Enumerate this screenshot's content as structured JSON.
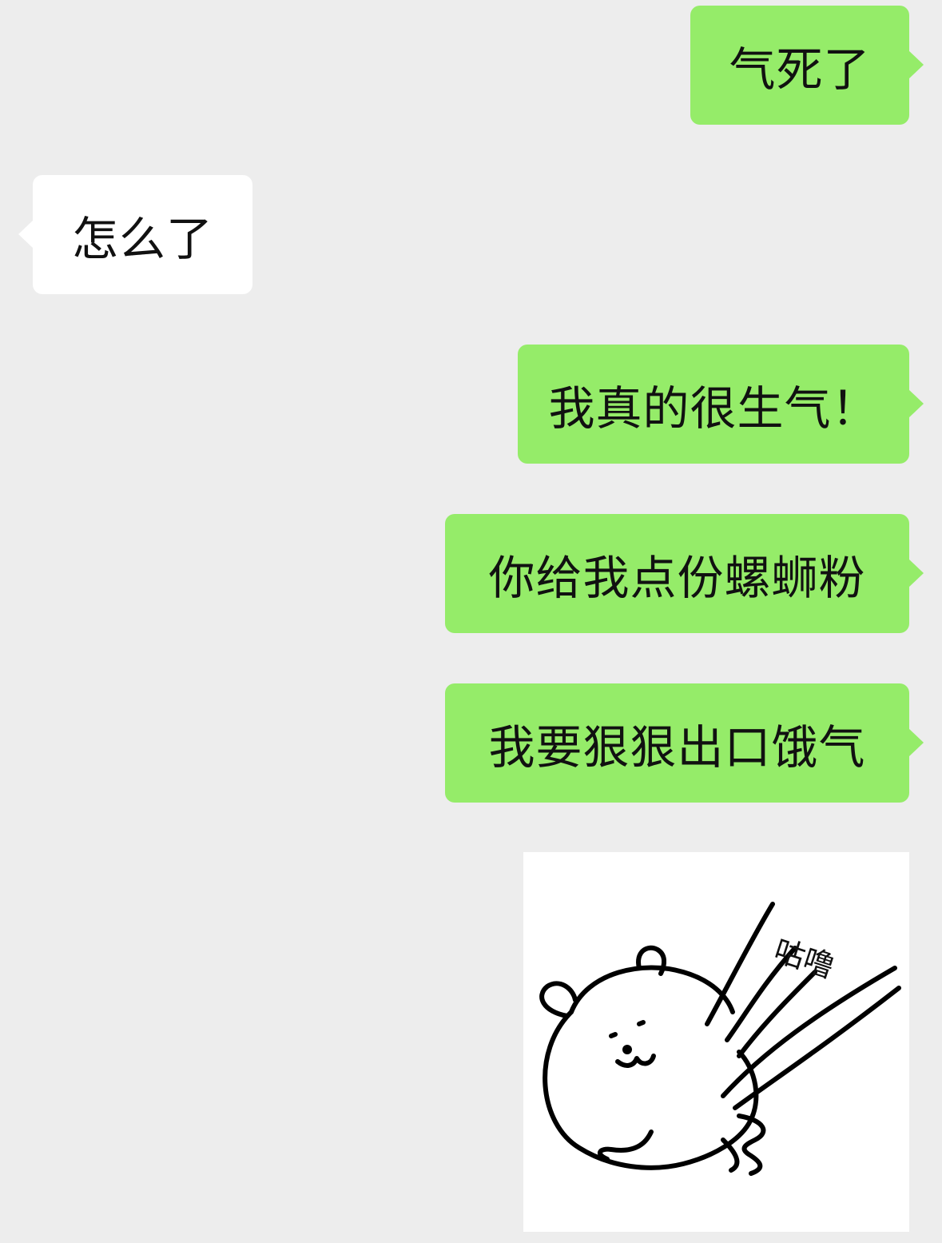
{
  "messages": [
    {
      "side": "out",
      "text": "气死了"
    },
    {
      "side": "in",
      "text": "怎么了"
    },
    {
      "side": "out",
      "text": "我真的很生气！"
    },
    {
      "side": "out",
      "text": "你给我点份螺蛳粉"
    },
    {
      "side": "out",
      "text": "我要狠狠出口饿气"
    }
  ],
  "sticker": {
    "type": "image",
    "description_icon": "bear-sticker-icon",
    "caption": "咕噜"
  },
  "colors": {
    "background": "#ededed",
    "outgoing_bubble": "#95ec69",
    "incoming_bubble": "#ffffff",
    "text": "#111111"
  }
}
